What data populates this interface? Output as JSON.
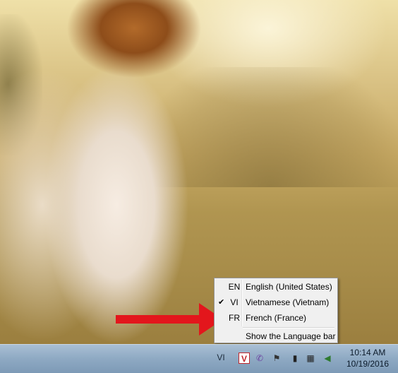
{
  "language_menu": {
    "items": [
      {
        "code": "EN",
        "label": "English (United States)",
        "checked": false
      },
      {
        "code": "VI",
        "label": "Vietnamese (Vietnam)",
        "checked": true
      },
      {
        "code": "FR",
        "label": "French (France)",
        "checked": false
      }
    ],
    "check_glyph": "✔",
    "show_bar_label": "Show the Language bar"
  },
  "taskbar": {
    "language_indicator": "VI",
    "tray_icons": [
      "v-app-icon",
      "viber-icon",
      "action-center-flag-icon",
      "battery-icon",
      "network-icon",
      "volume-icon"
    ],
    "clock_time": "10:14 AM",
    "clock_date": "10/19/2016"
  },
  "colors": {
    "annotation_arrow": "#e3161c",
    "taskbar": "#8ea9c3",
    "menu_background": "#f0f0f0"
  }
}
